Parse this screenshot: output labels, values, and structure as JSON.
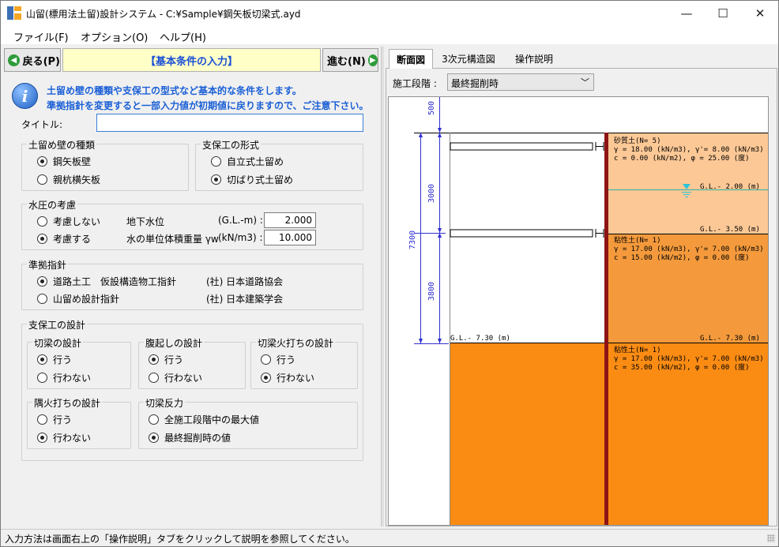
{
  "window": {
    "title": "山留(標用法土留)設計システム - C:¥Sample¥鋼矢板切梁式.ayd",
    "minimize": "—",
    "maximize": "☐",
    "close": "✕"
  },
  "menu": [
    "ファイル(F)",
    "オプション(O)",
    "ヘルプ(H)"
  ],
  "nav": {
    "back_label": "戻る(P)",
    "next_label": "進む(N)",
    "section_title": "【基本条件の入力】"
  },
  "info": {
    "line1": "土留め壁の種類や支保工の型式など基本的な条件をします。",
    "line2": "準拠指針を変更すると一部入力値が初期値に戻りますので、ご注意下さい。"
  },
  "title_field": {
    "label": "タイトル:",
    "value": ""
  },
  "wall_type": {
    "title": "土留め壁の種類",
    "options": [
      {
        "label": "鋼矢板壁",
        "selected": true
      },
      {
        "label": "親杭横矢板",
        "selected": false
      }
    ]
  },
  "support_type": {
    "title": "支保工の形式",
    "options": [
      {
        "label": "自立式土留め",
        "selected": false
      },
      {
        "label": "切ばり式土留め",
        "selected": true
      }
    ]
  },
  "water": {
    "title": "水圧の考慮",
    "options": [
      {
        "label": "考慮しない",
        "selected": false
      },
      {
        "label": "考慮する",
        "selected": true
      }
    ],
    "gwl_label": "地下水位",
    "gwl_unit": "(G.L.-m) :",
    "gwl_value": "2.000",
    "unit_weight_label": "水の単位体積重量 γw",
    "unit_weight_unit": "(kN/m3) :",
    "unit_weight_value": "10.000"
  },
  "standard": {
    "title": "準拠指針",
    "options": [
      {
        "label": "道路土工　仮設構造物工指針",
        "org": "(社) 日本道路協会",
        "selected": true
      },
      {
        "label": "山留め設計指針",
        "org": "(社) 日本建築学会",
        "selected": false
      }
    ]
  },
  "support_design": {
    "title": "支保工の設計",
    "strut": {
      "title": "切梁の設計",
      "options": [
        {
          "label": "行う",
          "selected": true
        },
        {
          "label": "行わない",
          "selected": false
        }
      ]
    },
    "wale": {
      "title": "腹起しの設計",
      "options": [
        {
          "label": "行う",
          "selected": true
        },
        {
          "label": "行わない",
          "selected": false
        }
      ]
    },
    "strut_brace": {
      "title": "切梁火打ちの設計",
      "options": [
        {
          "label": "行う",
          "selected": false
        },
        {
          "label": "行わない",
          "selected": true
        }
      ]
    },
    "corner_brace": {
      "title": "隅火打ちの設計",
      "options": [
        {
          "label": "行う",
          "selected": false
        },
        {
          "label": "行わない",
          "selected": true
        }
      ]
    },
    "strut_reaction": {
      "title": "切梁反力",
      "options": [
        {
          "label": "全施工段階中の最大値",
          "selected": false
        },
        {
          "label": "最終掘削時の値",
          "selected": true
        }
      ]
    }
  },
  "tabs": [
    {
      "label": "断面図",
      "active": true
    },
    {
      "label": "3次元構造図",
      "active": false
    },
    {
      "label": "操作説明",
      "active": false
    }
  ],
  "stage": {
    "label": "施工段階 :",
    "value": "最終掘削時",
    "chevron": "﹀"
  },
  "diagram": {
    "dims": {
      "top": "500",
      "total": "7300",
      "upper": "3000",
      "lower": "3800"
    },
    "layer1": {
      "name": "砂質土(N= 5)",
      "p1": "γ =  18.00 (kN/m3), γ'=  8.00 (kN/m3)",
      "p2": "c =   0.00 (kN/m2), φ = 25.00 (度)"
    },
    "gl_water": "G.L.-  2.00 (m)",
    "gl_350": "G.L.-  3.50 (m)",
    "layer2": {
      "name": "粘性土(N= 1)",
      "p1": "γ =  17.00 (kN/m3), γ'=  7.00 (kN/m3)",
      "p2": "c =  15.00 (kN/m2), φ =  0.00 (度)"
    },
    "gl_730_left": "G.L.-  7.30 (m)",
    "gl_730_right": "G.L.-  7.30 (m)",
    "layer3": {
      "name": "粘性土(N= 1)",
      "p1": "γ =  17.00 (kN/m3), γ'=  7.00 (kN/m3)",
      "p2": "c =  35.00 (kN/m2), φ =  0.00 (度)"
    },
    "colors": {
      "sand": "#fcc896",
      "clay": "#f49a3c",
      "deep": "#fa8c14",
      "wall": "#8c1414",
      "water": "#29c4d8"
    }
  },
  "status": {
    "text": "入力方法は画面右上の「操作説明」タブをクリックして説明を参照してください。"
  }
}
